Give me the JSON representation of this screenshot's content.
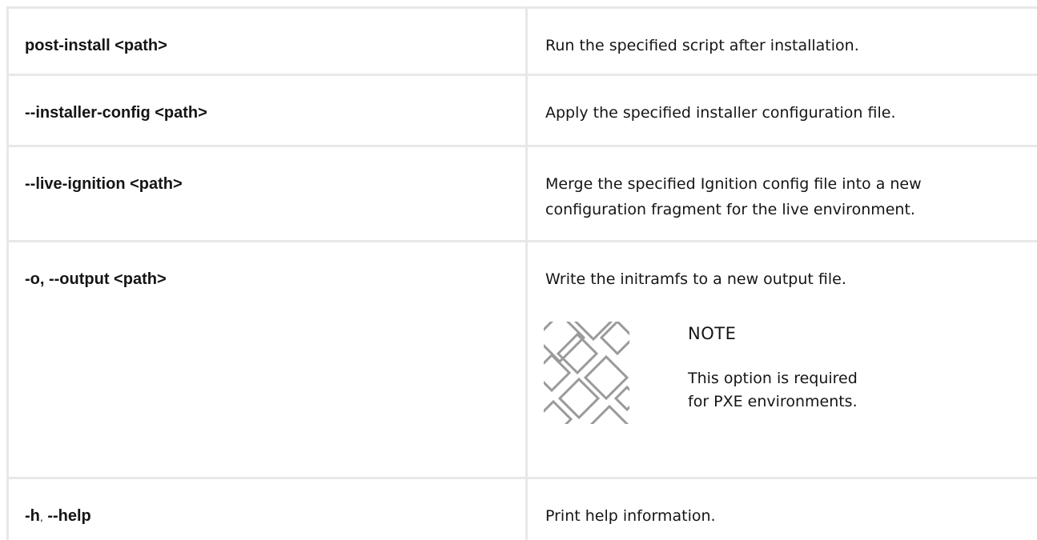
{
  "rows": [
    {
      "option": "post-install <path>",
      "description": "Run the specified script after installation."
    },
    {
      "option": "--installer-config <path>",
      "description": "Apply the specified installer configuration file."
    },
    {
      "option": "--live-ignition <path>",
      "description": "Merge the specified Ignition config file into a new configuration fragment for the live environment."
    },
    {
      "option": "-o, --output <path>",
      "description": "Write the initramfs to a new output file.",
      "note": {
        "icon": "note-diamond-pattern-icon",
        "title": "NOTE",
        "text": "This option is required for PXE environments."
      }
    },
    {
      "option_short": "-h",
      "option_sep": ",",
      "option_long": "--help",
      "description": "Print help information."
    }
  ],
  "colors": {
    "border": "#e8e8e8",
    "text": "#151515"
  }
}
